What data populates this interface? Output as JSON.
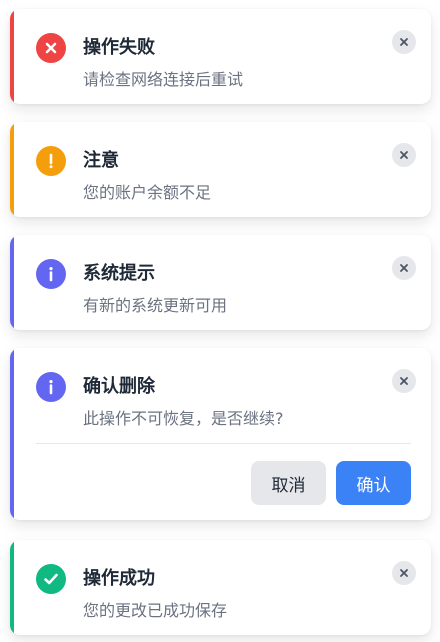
{
  "colors": {
    "error": "#ef4444",
    "warning": "#f59e0b",
    "info": "#6366f1",
    "success": "#10b981",
    "title_text": "#1f2937",
    "message_text": "#6b7280",
    "close_bg": "#e5e7eb",
    "confirm_button": "#3b82f6",
    "cancel_button": "#e5e7eb"
  },
  "toasts": [
    {
      "type": "error",
      "icon": "error-x-icon",
      "title": "操作失败",
      "message": "请检查网络连接后重试",
      "close_icon": "close-icon"
    },
    {
      "type": "warning",
      "icon": "warning-exclamation-icon",
      "title": "注意",
      "message": "您的账户余额不足",
      "close_icon": "close-icon"
    },
    {
      "type": "info",
      "icon": "info-icon",
      "title": "系统提示",
      "message": "有新的系统更新可用",
      "close_icon": "close-icon"
    },
    {
      "type": "info",
      "icon": "info-icon",
      "title": "确认删除",
      "message": "此操作不可恢复，是否继续?",
      "close_icon": "close-icon",
      "actions": {
        "cancel_label": "取消",
        "confirm_label": "确认"
      }
    },
    {
      "type": "success",
      "icon": "success-check-icon",
      "title": "操作成功",
      "message": "您的更改已成功保存",
      "close_icon": "close-icon"
    }
  ]
}
